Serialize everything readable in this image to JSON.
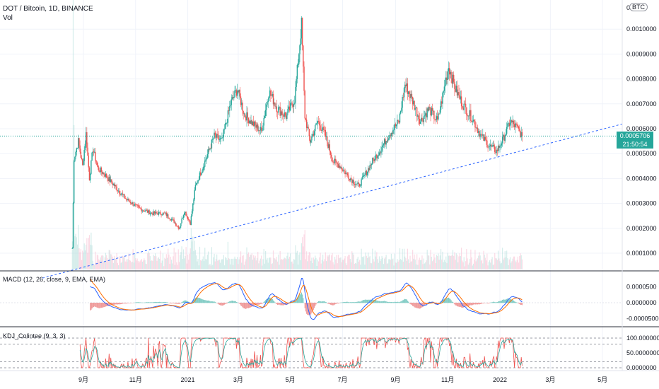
{
  "header": {
    "symbol_line": "DOT / Bitcoin, 1D, BINANCE",
    "vol_label": "Vol",
    "price_scale_top": "0.0",
    "currency_badge": "BTC"
  },
  "last_price": {
    "value": "0.0005706",
    "countdown": "21:50:54"
  },
  "colors": {
    "up": "#26a69a",
    "down": "#ef5350",
    "trendline": "#2962ff",
    "macd": "#2962ff",
    "signal": "#ff6d00",
    "k_line": "#ef5350",
    "d_line": "#26a69a"
  },
  "macd_panel": {
    "title": "MACD (12, 26, close, 9, EMA, EMA)",
    "y_labels": [
      "0.0000500",
      "0.0000000",
      "-0.0000500"
    ]
  },
  "kdj_panel": {
    "title": "KDJ_Colintee (9, 3, 3)",
    "y_labels": [
      "100.0000000",
      "50.0000000",
      "0.0000000"
    ]
  },
  "chart_data": {
    "type": "line",
    "title": "DOT / Bitcoin, 1D, BINANCE",
    "y_unit": "BTC",
    "x_tick_labels": [
      "9月",
      "11月",
      "2021",
      "3月",
      "5月",
      "7月",
      "9月",
      "11月",
      "2022",
      "3月",
      "5月"
    ],
    "x_tick_dates": [
      "2020-09-01",
      "2020-11-01",
      "2021-01-01",
      "2021-03-01",
      "2021-05-01",
      "2021-07-01",
      "2021-09-01",
      "2021-11-01",
      "2022-01-01",
      "2022-03-01",
      "2022-05-01"
    ],
    "y_tick_labels": [
      "0.0010000",
      "0.0009000",
      "0.0008000",
      "0.0007000",
      "0.0006000",
      "0.0005000",
      "0.0004000",
      "0.0003000",
      "0.0002000",
      "0.0001000"
    ],
    "y_ticks": [
      0.001,
      0.0009,
      0.0008,
      0.0007,
      0.0006,
      0.0005,
      0.0004,
      0.0003,
      0.0002,
      0.0001
    ],
    "ylim": [
      0.0,
      0.00107
    ],
    "grid": true,
    "series": [
      {
        "type": "close_price",
        "points": [
          [
            "2020-08-19",
            0.00012
          ],
          [
            "2020-08-21",
            0.00048
          ],
          [
            "2020-08-26",
            0.00055
          ],
          [
            "2020-08-31",
            0.00045
          ],
          [
            "2020-09-04",
            0.00058
          ],
          [
            "2020-09-08",
            0.0004
          ],
          [
            "2020-09-12",
            0.00052
          ],
          [
            "2020-09-18",
            0.00044
          ],
          [
            "2020-09-25",
            0.00042
          ],
          [
            "2020-10-05",
            0.00038
          ],
          [
            "2020-10-20",
            0.00032
          ],
          [
            "2020-11-05",
            0.00028
          ],
          [
            "2020-11-20",
            0.00026
          ],
          [
            "2020-12-05",
            0.00026
          ],
          [
            "2020-12-15",
            0.00023
          ],
          [
            "2020-12-22",
            0.0002
          ],
          [
            "2020-12-28",
            0.00027
          ],
          [
            "2021-01-04",
            0.00022
          ],
          [
            "2021-01-10",
            0.00037
          ],
          [
            "2021-01-20",
            0.00046
          ],
          [
            "2021-02-01",
            0.00057
          ],
          [
            "2021-02-10",
            0.00055
          ],
          [
            "2021-02-20",
            0.0007
          ],
          [
            "2021-02-28",
            0.00076
          ],
          [
            "2021-03-08",
            0.00066
          ],
          [
            "2021-03-18",
            0.00062
          ],
          [
            "2021-03-28",
            0.00059
          ],
          [
            "2021-04-06",
            0.00075
          ],
          [
            "2021-04-16",
            0.00068
          ],
          [
            "2021-04-26",
            0.00065
          ],
          [
            "2021-05-06",
            0.00072
          ],
          [
            "2021-05-14",
            0.00102
          ],
          [
            "2021-05-18",
            0.00065
          ],
          [
            "2021-05-24",
            0.00055
          ],
          [
            "2021-06-02",
            0.00063
          ],
          [
            "2021-06-10",
            0.00058
          ],
          [
            "2021-06-20",
            0.00047
          ],
          [
            "2021-06-28",
            0.00045
          ],
          [
            "2021-07-10",
            0.0004
          ],
          [
            "2021-07-20",
            0.00037
          ],
          [
            "2021-07-28",
            0.00042
          ],
          [
            "2021-08-05",
            0.00047
          ],
          [
            "2021-08-15",
            0.00052
          ],
          [
            "2021-08-25",
            0.00058
          ],
          [
            "2021-09-05",
            0.00063
          ],
          [
            "2021-09-12",
            0.00078
          ],
          [
            "2021-09-20",
            0.00072
          ],
          [
            "2021-09-30",
            0.00063
          ],
          [
            "2021-10-10",
            0.00068
          ],
          [
            "2021-10-20",
            0.00063
          ],
          [
            "2021-11-02",
            0.00085
          ],
          [
            "2021-11-10",
            0.00076
          ],
          [
            "2021-11-18",
            0.0007
          ],
          [
            "2021-11-30",
            0.00064
          ],
          [
            "2021-12-10",
            0.00057
          ],
          [
            "2021-12-20",
            0.00053
          ],
          [
            "2021-12-28",
            0.00051
          ],
          [
            "2022-01-05",
            0.00056
          ],
          [
            "2022-01-13",
            0.00063
          ],
          [
            "2022-01-22",
            0.0006
          ],
          [
            "2022-01-27",
            0.00057
          ]
        ]
      },
      {
        "type": "trendline",
        "points": [
          [
            "2020-07-15",
            0.0
          ],
          [
            "2022-05-25",
            0.00062
          ]
        ]
      }
    ],
    "last_value": 0.0005706
  }
}
